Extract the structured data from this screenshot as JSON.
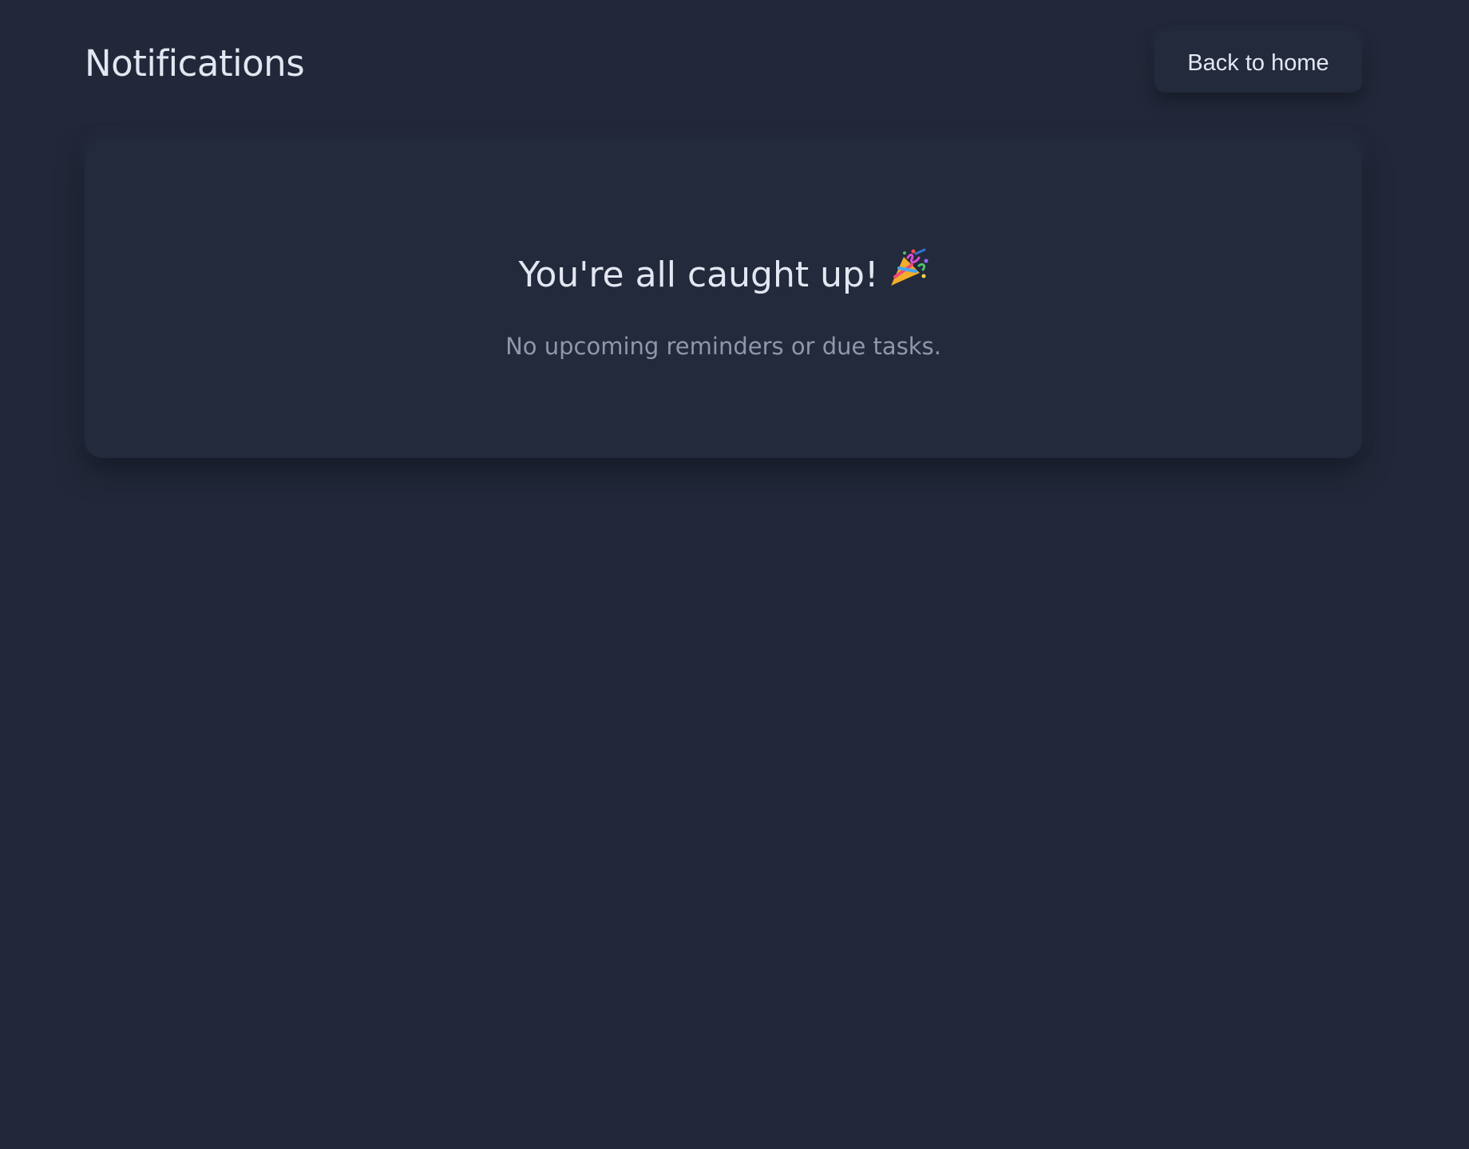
{
  "header": {
    "title": "Notifications",
    "back_label": "Back to home"
  },
  "empty_state": {
    "title": "You're all caught up!",
    "icon": "party-popper-icon",
    "subtitle": "No upcoming reminders or due tasks."
  },
  "colors": {
    "background": "#222839",
    "card": "#232a3b",
    "text": "#e3e7f2",
    "muted_text": "#8f97ad"
  }
}
